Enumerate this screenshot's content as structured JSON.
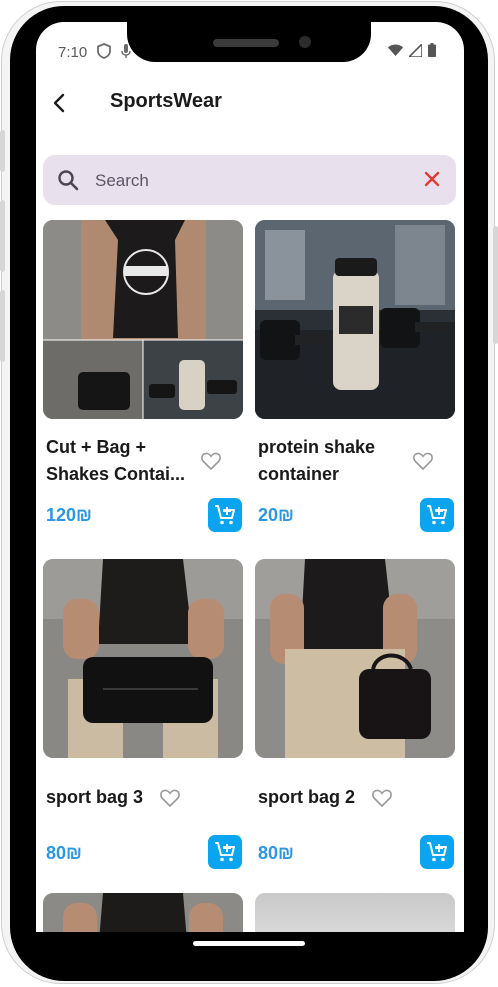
{
  "status_bar": {
    "time": "7:10"
  },
  "app_bar": {
    "title": "SportsWear"
  },
  "search": {
    "placeholder": "Search"
  },
  "products": [
    {
      "name_line1": "Cut + Bag +",
      "name_line2": "Shakes Contai...",
      "price": "120₪"
    },
    {
      "name_line1": "protein shake",
      "name_line2": "container",
      "price": "20₪"
    },
    {
      "name_line1": "sport bag 3",
      "price": "80₪"
    },
    {
      "name_line1": "sport bag 2",
      "price": "80₪"
    }
  ],
  "colors": {
    "price": "#2a97e3",
    "cart_button": "#0aa4f0",
    "search_bg": "#e8e0ec",
    "clear_icon": "#e53935"
  },
  "icons": [
    "back-arrow-icon",
    "search-icon",
    "clear-icon",
    "heart-outline-icon",
    "add-to-cart-icon",
    "wifi-icon",
    "signal-icon",
    "battery-icon"
  ]
}
